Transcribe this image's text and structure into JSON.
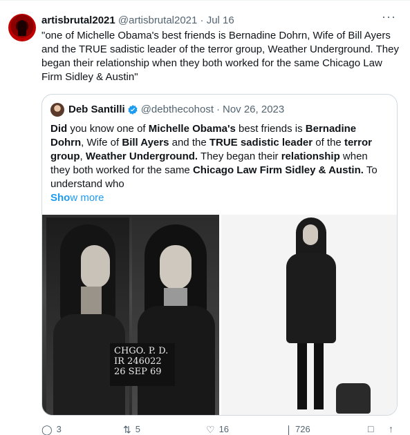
{
  "tweet": {
    "author_name": "artisbrutal2021",
    "author_handle": "@artisbrutal2021",
    "separator": "·",
    "date": "Jul 16",
    "more_label": "···",
    "text": "\"one of Michelle Obama's best friends is Bernadine Dohrn, Wife of Bill Ayers and the TRUE sadistic leader of the terror group, Weather Underground. They began their relationship when they both worked for the same Chicago Law Firm Sidley & Austin\""
  },
  "quote": {
    "author_name": "Deb Santilli",
    "author_handle": "@debthecohost",
    "separator": "·",
    "date": "Nov 26, 2023",
    "text_parts": [
      {
        "t": "Did",
        "b": true
      },
      {
        "t": " you know one of ",
        "b": false
      },
      {
        "t": "Michelle Obama's",
        "b": true
      },
      {
        "t": " best friends is ",
        "b": false
      },
      {
        "t": "Bernadine Dohrn",
        "b": true
      },
      {
        "t": ", Wife of ",
        "b": false
      },
      {
        "t": "Bill Ayers",
        "b": true
      },
      {
        "t": " and the ",
        "b": false
      },
      {
        "t": "TRUE sadistic leader",
        "b": true
      },
      {
        "t": " of the ",
        "b": false
      },
      {
        "t": "terror group",
        "b": true
      },
      {
        "t": ", ",
        "b": false
      },
      {
        "t": "Weather Underground.",
        "b": true
      },
      {
        "t": " They began their ",
        "b": false
      },
      {
        "t": "relationship",
        "b": true
      },
      {
        "t": " when they both worked for the same ",
        "b": false
      },
      {
        "t": "Chicago Law Firm Sidley & Austin.",
        "b": true
      },
      {
        "t": "  To understand who",
        "b": false
      }
    ],
    "show_more_bold": "Sho",
    "show_more_rest": "w more",
    "placard": [
      "CHGO. P. D.",
      "IR 246022",
      "26 SEP 69"
    ]
  },
  "actions": {
    "reply_count": "3",
    "repost_count": "5",
    "like_count": "16",
    "views_count": "726"
  },
  "colors": {
    "link": "#1d9bf0",
    "muted": "#536471",
    "border": "#cfd9de"
  }
}
